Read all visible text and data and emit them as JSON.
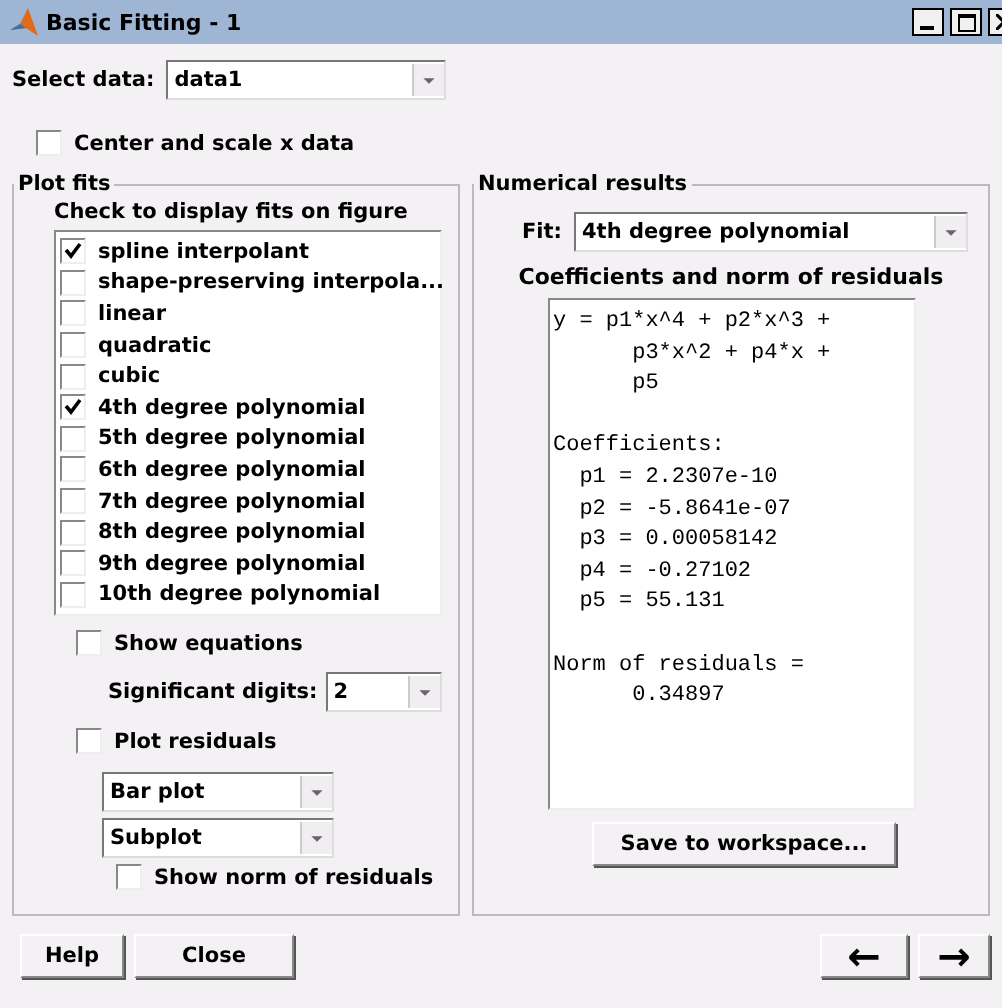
{
  "window": {
    "title": "Basic Fitting - 1"
  },
  "select_data": {
    "label": "Select data:",
    "value": "data1"
  },
  "center_scale": {
    "label": "Center and scale x data",
    "checked": false
  },
  "plot_fits": {
    "title": "Plot fits",
    "heading": "Check to display fits on figure",
    "fits": [
      {
        "label": "spline interpolant",
        "checked": true
      },
      {
        "label": "shape-preserving interpola...",
        "checked": false
      },
      {
        "label": "linear",
        "checked": false
      },
      {
        "label": "quadratic",
        "checked": false
      },
      {
        "label": "cubic",
        "checked": false
      },
      {
        "label": "4th degree polynomial",
        "checked": true
      },
      {
        "label": "5th degree polynomial",
        "checked": false
      },
      {
        "label": "6th degree polynomial",
        "checked": false
      },
      {
        "label": "7th degree polynomial",
        "checked": false
      },
      {
        "label": "8th degree polynomial",
        "checked": false
      },
      {
        "label": "9th degree polynomial",
        "checked": false
      },
      {
        "label": "10th degree polynomial",
        "checked": false
      }
    ],
    "show_equations": {
      "label": "Show equations",
      "checked": false
    },
    "significant_digits": {
      "label": "Significant digits:",
      "value": "2"
    },
    "plot_residuals": {
      "label": "Plot residuals",
      "checked": false
    },
    "plot_style": {
      "value": "Bar plot"
    },
    "plot_location": {
      "value": "Subplot"
    },
    "show_norm": {
      "label": "Show norm of residuals",
      "checked": false
    }
  },
  "numerical_results": {
    "title": "Numerical results",
    "fit_label": "Fit:",
    "fit_value": "4th degree polynomial",
    "heading": "Coefficients and norm of residuals",
    "blocks": [
      [
        "y = p1*x^4 + p2*x^3 +",
        "      p3*x^2 + p4*x +",
        "      p5"
      ],
      [
        "Coefficients:",
        "  p1 = 2.2307e-10",
        "  p2 = -5.8641e-07",
        "  p3 = 0.00058142",
        "  p4 = -0.27102",
        "  p5 = 55.131"
      ],
      [
        "Norm of residuals =",
        "      0.34897"
      ]
    ],
    "save_button": "Save to workspace..."
  },
  "buttons": [
    "Help",
    "Close"
  ],
  "nav_buttons": [
    "←",
    "→"
  ]
}
